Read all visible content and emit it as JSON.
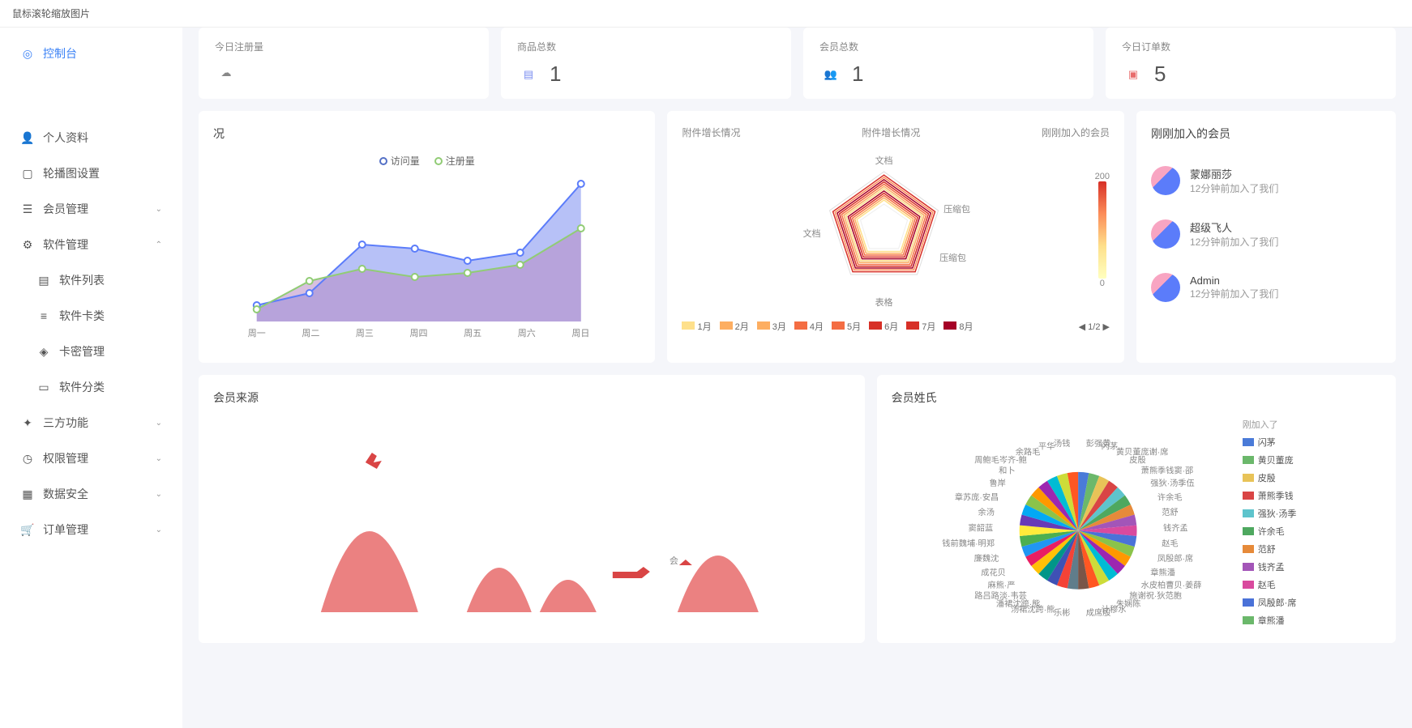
{
  "topbar": "鼠标滚轮缩放图片",
  "sidebar": {
    "console": "控制台",
    "profile": "个人资料",
    "carousel": "轮播图设置",
    "members": "会员管理",
    "software": "软件管理",
    "sw_list": "软件列表",
    "sw_cards": "软件卡类",
    "sw_keys": "卡密管理",
    "sw_category": "软件分类",
    "third": "三方功能",
    "perm": "权限管理",
    "data_safe": "数据安全",
    "orders": "订单管理"
  },
  "stats": {
    "reg_today_label": "今日注册量",
    "goods_label": "商品总数",
    "goods_value": "1",
    "members_label": "会员总数",
    "members_value": "1",
    "orders_label": "今日订单数",
    "orders_value": "5"
  },
  "line": {
    "title": "况",
    "legend_visit": "访问量",
    "legend_reg": "注册量",
    "xaxis": [
      "周一",
      "周二",
      "周三",
      "周四",
      "周五",
      "周六",
      "周日"
    ]
  },
  "radar": {
    "title1": "附件增长情况",
    "title2": "附件增长情况",
    "title3": "刚刚加入的会员",
    "axis1": "文档",
    "axis2": "压缩包",
    "axis3": "文档",
    "axis4": "压缩包",
    "axis5": "表格",
    "scale_max": "200",
    "scale_min": "0",
    "months": [
      "1月",
      "2月",
      "3月",
      "4月",
      "5月",
      "6月",
      "7月",
      "8月"
    ],
    "pager": "1/2"
  },
  "new_members": {
    "title": "刚刚加入的会员",
    "list": [
      {
        "name": "蒙娜丽莎",
        "sub": "12分钟前加入了我们"
      },
      {
        "name": "超级飞人",
        "sub": "12分钟前加入了我们"
      },
      {
        "name": "Admin",
        "sub": "12分钟前加入了我们"
      }
    ]
  },
  "source": {
    "title": "会员来源",
    "label": "会"
  },
  "pie": {
    "title": "会员姓氏",
    "labels": [
      "彭强黄",
      "闪茅",
      "黄贝董庞谢·席",
      "皮殷",
      "萧熊季钱窦·邵",
      "强狄·汤季伍",
      "许余毛",
      "范舒",
      "钱齐孟",
      "赵毛",
      "凤殷郎·席",
      "章熊潘",
      "水皮柏曹贝·姜薛",
      "施谢祝·狄范胞",
      "朱娴陈",
      "计穆水",
      "成席殷",
      "乐彬",
      "汤裙沈跨·熊",
      "潘裙沈跨·熊",
      "路吕路淡·韦芸",
      "麻熊·严",
      "成花贝",
      "廉魏沈",
      "钱前魏埔·明郑",
      "窦韶蓝",
      "余汤",
      "章苏庞·安昌",
      "鲁岸",
      "和卜",
      "周鲍毛岑齐-鲍",
      "余路毛",
      "平华",
      "汤钱"
    ],
    "legend_top": "刚加入了",
    "legend": [
      {
        "label": "闪茅",
        "color": "#4a7bd8"
      },
      {
        "label": "黄贝董庞",
        "color": "#6bb86b"
      },
      {
        "label": "皮殷",
        "color": "#e8c358"
      },
      {
        "label": "萧熊季钱",
        "color": "#d94545"
      },
      {
        "label": "强狄·汤季",
        "color": "#5ec4cc"
      },
      {
        "label": "许余毛",
        "color": "#4ea85f"
      },
      {
        "label": "范舒",
        "color": "#e68a3a"
      },
      {
        "label": "钱齐孟",
        "color": "#a355b8"
      },
      {
        "label": "赵毛",
        "color": "#d94a9e"
      },
      {
        "label": "凤殷郎·席",
        "color": "#4a72d8"
      },
      {
        "label": "章熊潘",
        "color": "#6bb86b"
      }
    ]
  },
  "chart_data": [
    {
      "type": "area",
      "title": "况",
      "categories": [
        "周一",
        "周二",
        "周三",
        "周四",
        "周五",
        "周六",
        "周日"
      ],
      "series": [
        {
          "name": "访问量",
          "values": [
            120,
            150,
            280,
            260,
            230,
            250,
            480
          ],
          "color": "#5b7cfa"
        },
        {
          "name": "注册量",
          "values": [
            110,
            180,
            210,
            190,
            200,
            220,
            310
          ],
          "color": "#91cc75"
        }
      ],
      "xlabel": "",
      "ylabel": "",
      "ylim": [
        0,
        500
      ]
    },
    {
      "type": "radar",
      "title": "附件增长情况",
      "axes": [
        "文档",
        "压缩包",
        "文档",
        "压缩包",
        "表格"
      ],
      "series_range": {
        "min": 0,
        "max": 200
      },
      "note": "12 overlapping radar polygons colored by month gradient yellow→red"
    },
    {
      "type": "pie",
      "title": "会员姓氏",
      "note": "many thin slices; labels listed in pie.labels"
    }
  ]
}
